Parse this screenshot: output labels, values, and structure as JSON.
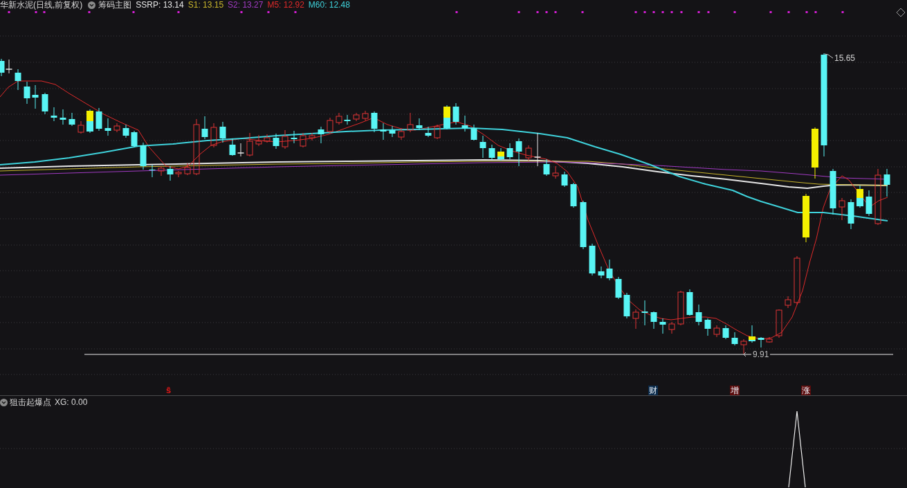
{
  "header": {
    "title": "华新水泥(日线,前复权)",
    "indicator": "筹码主图",
    "readings": [
      {
        "text": "SSRP: 13.14",
        "color": "#e6e6e6"
      },
      {
        "text": "S1: 13.15",
        "color": "#c9b62c"
      },
      {
        "text": "S2: 13.27",
        "color": "#a23bc4"
      },
      {
        "text": "M5: 12.92",
        "color": "#e02a2a"
      },
      {
        "text": "M60: 12.48",
        "color": "#3fd3dc"
      }
    ]
  },
  "main_chart": {
    "high_label": "15.65",
    "low_label": "9.91"
  },
  "event_markers": [
    {
      "kind": "letter",
      "label": "ŝ",
      "color": "#e01818"
    },
    {
      "kind": "tag",
      "label": "财",
      "color": "#0c2c4c"
    },
    {
      "kind": "tag",
      "label": "增",
      "color": "#5c0c0c"
    },
    {
      "kind": "tag",
      "label": "涨",
      "color": "#5c0c0c"
    }
  ],
  "sub_panel": {
    "title": "狙击起爆点",
    "reading": "XG: 0.00"
  }
}
